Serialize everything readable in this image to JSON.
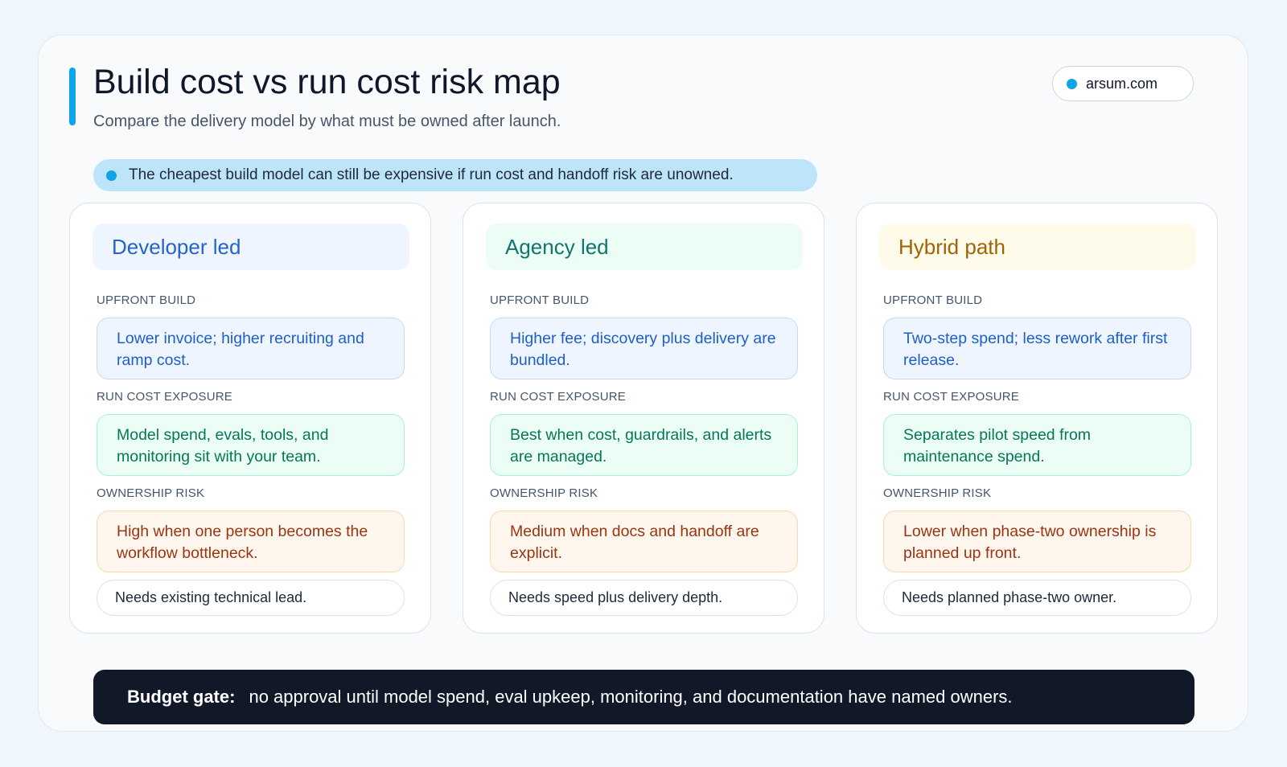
{
  "header": {
    "title": "Build cost vs run cost risk map",
    "subtitle": "Compare the delivery model by what must be owned after launch.",
    "site": "arsum.com"
  },
  "note": "The cheapest build model can still be expensive if run cost and handoff risk are unowned.",
  "section_labels": {
    "build": "UPFRONT BUILD",
    "run": "RUN COST EXPOSURE",
    "risk": "OWNERSHIP RISK"
  },
  "columns": [
    {
      "title": "Developer led",
      "build": "Lower invoice; higher recruiting and ramp cost.",
      "run": "Model spend, evals, tools, and monitoring sit with your team.",
      "risk": "High when one person becomes the workflow bottleneck.",
      "need": "Needs existing technical lead."
    },
    {
      "title": "Agency led",
      "build": "Higher fee; discovery plus delivery are bundled.",
      "run": "Best when cost, guardrails, and alerts are managed.",
      "risk": "Medium when docs and handoff are explicit.",
      "need": "Needs speed plus delivery depth."
    },
    {
      "title": "Hybrid path",
      "build": "Two-step spend; less rework after first release.",
      "run": "Separates pilot speed from maintenance spend.",
      "risk": "Lower when phase-two ownership is planned up front.",
      "need": "Needs planned phase-two owner."
    }
  ],
  "budget_gate": {
    "label": "Budget gate:",
    "text": "no approval until model spend, eval upkeep, monitoring, and documentation have named owners."
  },
  "colors": {
    "accent": "#0ea5e9",
    "developer": "#2563c9",
    "agency": "#0f766e",
    "hybrid": "#a16207",
    "dark_bar": "#111827"
  }
}
